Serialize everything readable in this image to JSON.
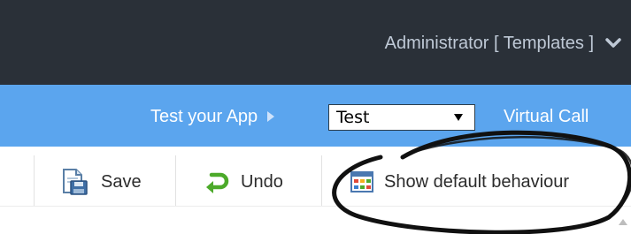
{
  "header": {
    "user_label": "Administrator [ Templates ]",
    "menu_icon": "chevron-down-icon"
  },
  "nav": {
    "test_app_label": "Test your App",
    "test_app_icon": "caret-right-icon",
    "environment_select": {
      "selected": "Test",
      "icon": "dropdown-arrow-icon"
    },
    "virtual_call_label": "Virtual Call"
  },
  "toolbar": {
    "save": {
      "label": "Save",
      "icon": "save-icon"
    },
    "undo": {
      "label": "Undo",
      "icon": "undo-icon"
    },
    "show_default": {
      "label": "Show default behaviour",
      "icon": "grid-icon"
    }
  },
  "colors": {
    "topbar": "#2a3038",
    "bluebar": "#5ba5ee",
    "undo_green": "#4caa2a",
    "annotation": "#111111"
  }
}
